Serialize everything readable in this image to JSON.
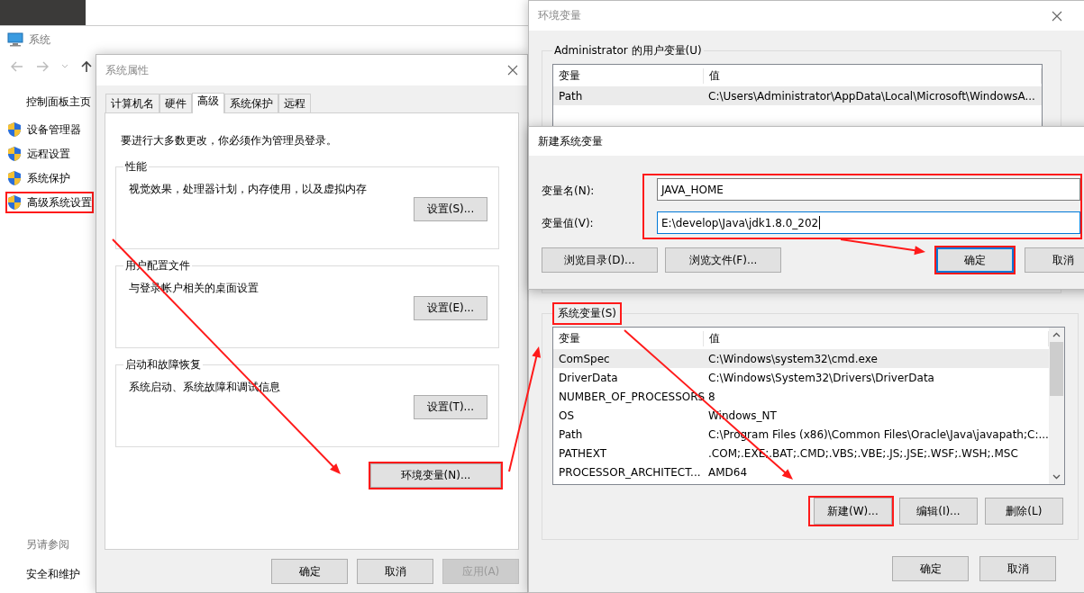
{
  "system_window": {
    "title": "系统",
    "sidebar_home": "控制面板主页",
    "links": [
      {
        "label": "设备管理器",
        "highlighted": false
      },
      {
        "label": "远程设置",
        "highlighted": false
      },
      {
        "label": "系统保护",
        "highlighted": false
      },
      {
        "label": "高级系统设置",
        "highlighted": true
      }
    ],
    "see_also": "另请参阅",
    "see_also_links": [
      "安全和维护"
    ]
  },
  "system_properties": {
    "title": "系统属性",
    "tabs": [
      {
        "label": "计算机名",
        "selected": false
      },
      {
        "label": "硬件",
        "selected": false
      },
      {
        "label": "高级",
        "selected": true
      },
      {
        "label": "系统保护",
        "selected": false
      },
      {
        "label": "远程",
        "selected": false
      }
    ],
    "notice": "要进行大多数更改，你必须作为管理员登录。",
    "groups": [
      {
        "title": "性能",
        "description": "视觉效果，处理器计划，内存使用，以及虚拟内存",
        "button": "设置(S)..."
      },
      {
        "title": "用户配置文件",
        "description": "与登录帐户相关的桌面设置",
        "button": "设置(E)..."
      },
      {
        "title": "启动和故障恢复",
        "description": "系统启动、系统故障和调试信息",
        "button": "设置(T)..."
      }
    ],
    "env_button": {
      "label": "环境变量(N)...",
      "highlighted": true
    },
    "buttons": [
      {
        "label": "确定",
        "disabled": false
      },
      {
        "label": "取消",
        "disabled": false
      },
      {
        "label": "应用(A)",
        "disabled": true
      }
    ]
  },
  "environment_variables": {
    "title": "环境变量",
    "user_group": "Administrator 的用户变量(U)",
    "user_table": {
      "columns": [
        "变量",
        "值"
      ],
      "rows": [
        {
          "cells": [
            "Path",
            "C:\\Users\\Administrator\\AppData\\Local\\Microsoft\\WindowsA..."
          ],
          "selected": true
        }
      ]
    },
    "system_group": {
      "label": "系统变量(S)",
      "highlighted": true
    },
    "system_table": {
      "columns": [
        "变量",
        "值"
      ],
      "rows": [
        {
          "cells": [
            "ComSpec",
            "C:\\Windows\\system32\\cmd.exe"
          ],
          "selected": true
        },
        {
          "cells": [
            "DriverData",
            "C:\\Windows\\System32\\Drivers\\DriverData"
          ],
          "selected": false
        },
        {
          "cells": [
            "NUMBER_OF_PROCESSORS",
            "8"
          ],
          "selected": false
        },
        {
          "cells": [
            "OS",
            "Windows_NT"
          ],
          "selected": false
        },
        {
          "cells": [
            "Path",
            "C:\\Program Files (x86)\\Common Files\\Oracle\\Java\\javapath;C:..."
          ],
          "selected": false
        },
        {
          "cells": [
            "PATHEXT",
            ".COM;.EXE;.BAT;.CMD;.VBS;.VBE;.JS;.JSE;.WSF;.WSH;.MSC"
          ],
          "selected": false
        },
        {
          "cells": [
            "PROCESSOR_ARCHITECT...",
            "AMD64"
          ],
          "selected": false
        }
      ]
    },
    "system_buttons": [
      {
        "label": "新建(W)...",
        "highlighted": true
      },
      {
        "label": "编辑(I)...",
        "highlighted": false
      },
      {
        "label": "删除(L)",
        "highlighted": false
      }
    ],
    "buttons": [
      "确定",
      "取消"
    ]
  },
  "new_variable_dialog": {
    "title": "新建系统变量",
    "fields_highlighted": true,
    "fields": [
      {
        "label": "变量名(N):",
        "value": "JAVA_HOME",
        "focused": false
      },
      {
        "label": "变量值(V):",
        "value": "E:\\develop\\Java\\jdk1.8.0_202",
        "focused": true
      }
    ],
    "browse_buttons": [
      "浏览目录(D)...",
      "浏览文件(F)..."
    ],
    "buttons": [
      {
        "label": "确定",
        "highlighted": true,
        "default": true
      },
      {
        "label": "取消",
        "highlighted": false,
        "default": false
      }
    ]
  }
}
